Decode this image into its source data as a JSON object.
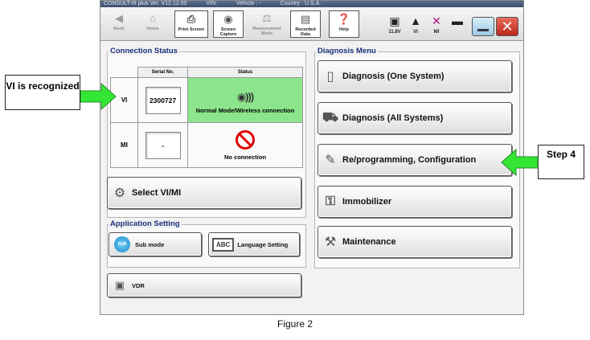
{
  "window": {
    "title_segments": [
      "CONSULT-III plus  Ver. V12.12.00",
      "VIN:",
      "Vehicle : -",
      "Country : U.S.A."
    ]
  },
  "toolbar": {
    "buttons": [
      {
        "label": "Back",
        "icon": "back-arrow-icon"
      },
      {
        "label": "Home",
        "icon": "home-icon"
      },
      {
        "label": "Print Screen",
        "icon": "printer-icon"
      },
      {
        "label": "Screen Capture",
        "icon": "camera-icon"
      },
      {
        "label": "Measurement Mode",
        "icon": "meter-icon"
      },
      {
        "label": "Recorded Data",
        "icon": "recorded-data-icon"
      },
      {
        "label": "Help",
        "icon": "help-icon"
      }
    ],
    "status": {
      "voltage": "11.8V",
      "vi": "VI",
      "mi": "MI"
    }
  },
  "connection": {
    "title": "Connection Status",
    "columns": [
      "Serial No.",
      "Status"
    ],
    "rows": [
      {
        "label": "VI",
        "serial": "2300727",
        "status": "Normal Mode/Wireless connection",
        "ok": true
      },
      {
        "label": "MI",
        "serial": "-",
        "status": "No connection",
        "ok": false
      }
    ],
    "select_button": "Select VI/MI"
  },
  "application_setting": {
    "title": "Application Setting",
    "sub_mode": "Sub mode",
    "sub_icon_text": "SUB",
    "language": "Language Setting",
    "language_icon_text": "ABC"
  },
  "vdr": {
    "label": "VDR"
  },
  "diagnosis": {
    "title": "Diagnosis Menu",
    "items": [
      {
        "label": "Diagnosis (One System)",
        "icon": "handheld-icon"
      },
      {
        "label": "Diagnosis (All Systems)",
        "icon": "car-scan-icon"
      },
      {
        "label": "Re/programming, Configuration",
        "icon": "reprogramming-icon"
      },
      {
        "label": "Immobilizer",
        "icon": "immobilizer-icon"
      },
      {
        "label": "Maintenance",
        "icon": "maintenance-icon"
      }
    ]
  },
  "annotations": {
    "vi_callout": "VI is recognized",
    "step_callout": "Step 4",
    "figure_caption": "Figure 2",
    "arrow_color": "#33e633"
  }
}
